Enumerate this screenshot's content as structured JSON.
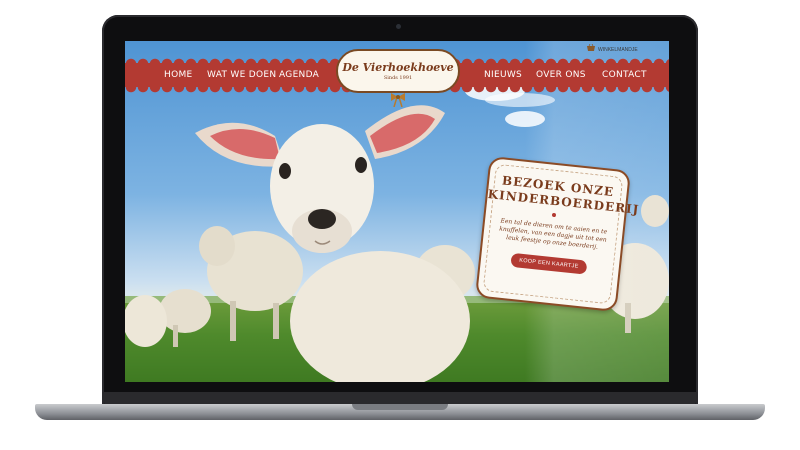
{
  "nav": {
    "items_left": [
      {
        "label": "HOME",
        "name": "nav-home"
      },
      {
        "label": "WAT WE DOEN",
        "name": "nav-wat-we-doen"
      },
      {
        "label": "AGENDA",
        "name": "nav-agenda"
      }
    ],
    "items_right": [
      {
        "label": "NIEUWS",
        "name": "nav-nieuws"
      },
      {
        "label": "OVER ONS",
        "name": "nav-over-ons"
      },
      {
        "label": "CONTACT",
        "name": "nav-contact"
      }
    ]
  },
  "logo": {
    "name": "De Vierhoekhoeve",
    "since": "Sinds 1991"
  },
  "cart": {
    "label": "WINKELMANDJE",
    "icon": "basket-icon"
  },
  "promo": {
    "title_line1": "BEZOEK ONZE",
    "title_line2": "KINDERBOERDERIJ",
    "text": "Een tal de dieren om te aaien en te knuffelen, van een dagje uit tot een leuk feestje op onze boerderij.",
    "button_label": "KOOP EEN KAARTJE"
  },
  "slider": {
    "count": 5,
    "active_index": 0
  },
  "colors": {
    "brand_red": "#b33a32",
    "brand_brown": "#7a3b1c",
    "cream": "#fbf8f2"
  }
}
